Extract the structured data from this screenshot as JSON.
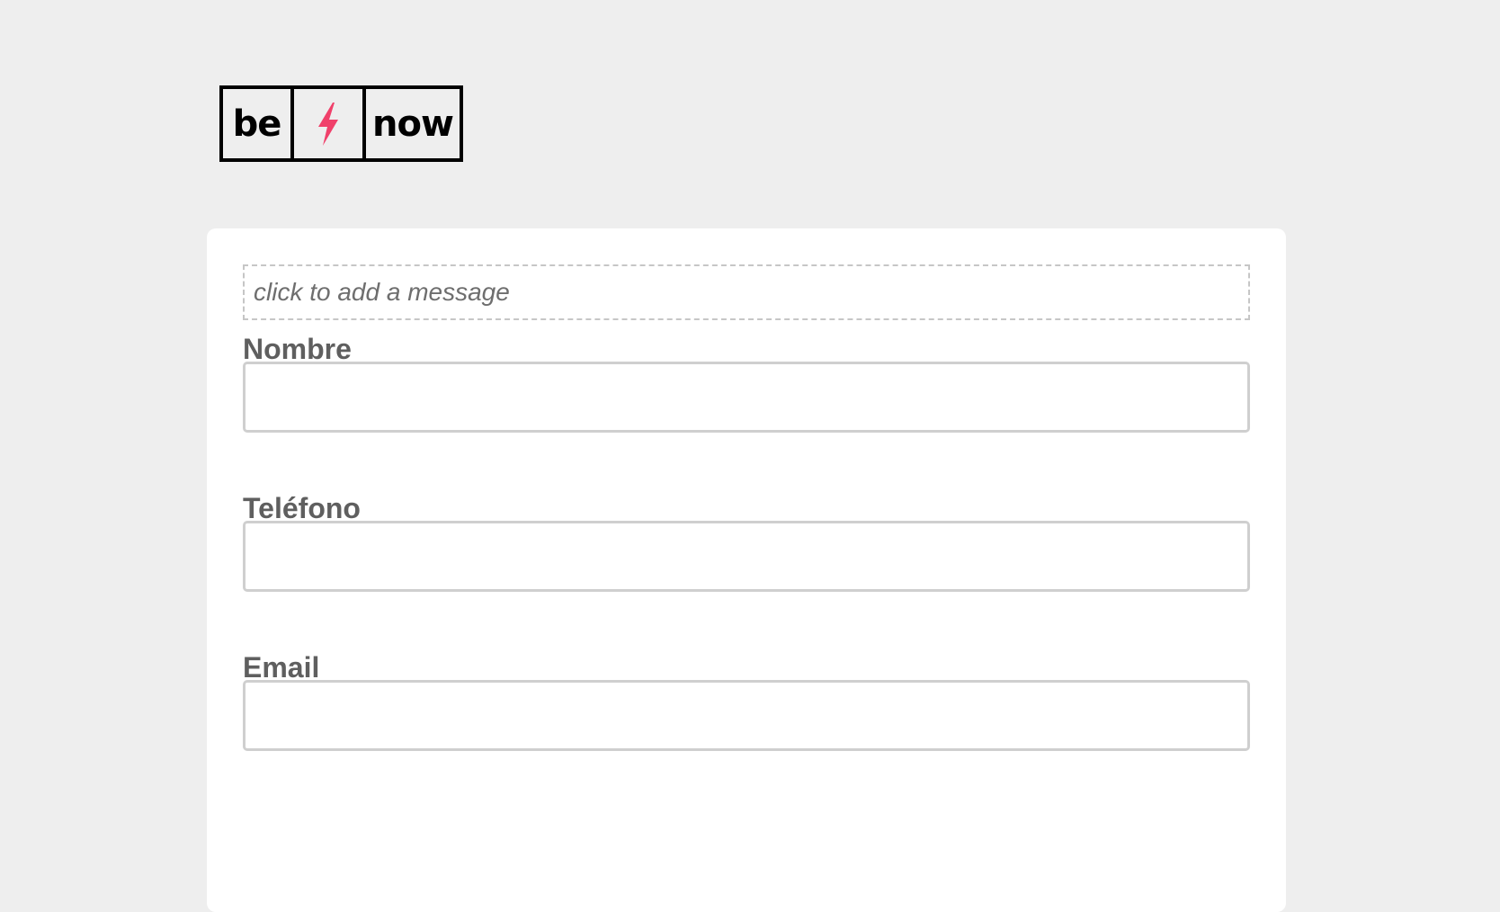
{
  "brand": {
    "logo_left": "be",
    "logo_right": "now",
    "bolt_icon": "lightning-bolt-icon",
    "bolt_color": "#f0406a"
  },
  "form": {
    "message_placeholder": "click to add a message",
    "fields": [
      {
        "label": "Nombre",
        "value": ""
      },
      {
        "label": "Teléfono",
        "value": ""
      },
      {
        "label": "Email",
        "value": ""
      }
    ]
  },
  "colors": {
    "page_background": "#eeeeee",
    "card_background": "#ffffff",
    "label_text": "#5f5f5f",
    "input_border": "#cfcfcf"
  }
}
